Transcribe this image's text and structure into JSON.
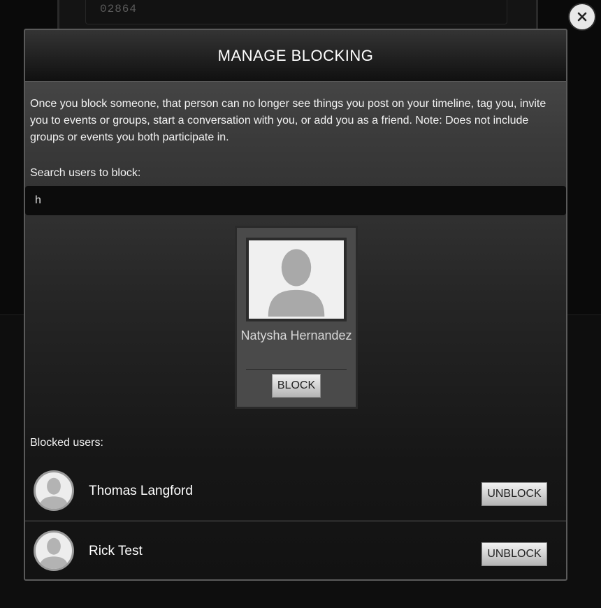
{
  "background": {
    "field_value": "02864"
  },
  "modal": {
    "title": "MANAGE BLOCKING",
    "description": "Once you block someone, that person can no longer see things you post on your timeline, tag you, invite you to events or groups, start a conversation with you, or add you as a friend. Note: Does not include groups or events you both participate in.",
    "search_label": "Search users to block:",
    "search_value": "h",
    "result": {
      "name": "Natysha Hernandez",
      "button_label": "BLOCK"
    },
    "blocked_label": "Blocked users:",
    "blocked_users": [
      {
        "name": "Thomas Langford",
        "button_label": "UNBLOCK"
      },
      {
        "name": "Rick Test",
        "button_label": "UNBLOCK"
      }
    ]
  },
  "icons": {
    "close": "close-icon",
    "avatar": "person-silhouette-icon"
  },
  "colors": {
    "placeholder_fill": "#f0f0f0",
    "silhouette": "#a9a9a9"
  }
}
